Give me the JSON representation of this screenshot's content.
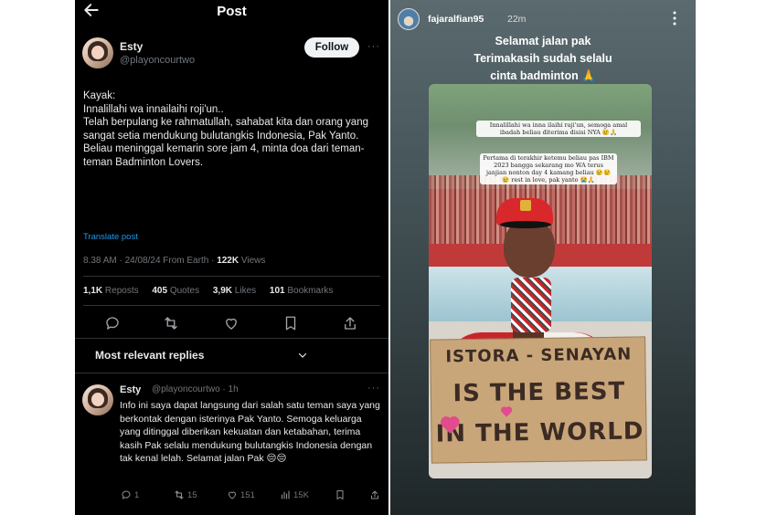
{
  "x_post": {
    "header_title": "Post",
    "author": {
      "name": "Esty",
      "handle": "@playoncourtwo"
    },
    "follow_label": "Follow",
    "more_label": "···",
    "text_lines": [
      "Kayak:",
      "Innalillahi wa innailaihi roji'un..",
      "Telah berpulang ke rahmatullah, sahabat kita dan orang yang sangat setia mendukung bulutangkis Indonesia, Pak Yanto. Beliau meninggal kemarin sore jam 4, minta doa dari teman-teman Badminton Lovers."
    ],
    "translate_label": "Translate post",
    "meta": {
      "time": "8.38 AM · 24/08/24 From Earth ·",
      "views_count": "122K",
      "views_label": "Views"
    },
    "stats": [
      {
        "count": "1,1K",
        "label": "Reposts"
      },
      {
        "count": "405",
        "label": "Quotes"
      },
      {
        "count": "3,9K",
        "label": "Likes"
      },
      {
        "count": "101",
        "label": "Bookmarks"
      }
    ],
    "actions": [
      "reply-icon",
      "repost-icon",
      "like-icon",
      "bookmark-icon",
      "share-icon"
    ],
    "replies_sort_label": "Most relevant replies",
    "reply": {
      "name": "Esty",
      "handle": "@playoncourtwo · 1h",
      "text": "Info ini saya dapat langsung dari salah satu teman saya yang berkontak dengan isterinya Pak Yanto. Semoga keluarga yang ditinggal diberikan kekuatan dan ketabahan, terima kasih Pak selalu mendukung bulutangkis Indonesia dengan tak kenal lelah. Selamat jalan Pak 😔😔",
      "stats": [
        {
          "icon": "reply-icon",
          "value": "1"
        },
        {
          "icon": "repost-icon",
          "value": "15"
        },
        {
          "icon": "like-icon",
          "value": "151"
        },
        {
          "icon": "views-icon",
          "value": "15K"
        },
        {
          "icon": "bookmark-icon",
          "value": ""
        },
        {
          "icon": "share-icon",
          "value": ""
        }
      ]
    }
  },
  "story": {
    "username": "fajaralfian95",
    "time": "22m",
    "caption_lines": [
      "Selamat jalan pak",
      "Terimakasih sudah selalu",
      "cinta badminton 🙏"
    ],
    "photo_overlay_1": "Innalillahi wa inna ilaihi raji'un, semoga amal ibadah beliau diterima disisi NYA 😢🙏",
    "photo_overlay_2": "Pertama di terakhir ketemu beliau pas IBM 2023 bangga sekarang mo WA terus janjian nonton day 4 kamang beliau 😢😢😢 rest in love, pak yanto 😭🙏",
    "sign_lines": [
      "ISTORA - SENAYAN",
      "IS THE BEST",
      "IN THE WORLD"
    ]
  }
}
